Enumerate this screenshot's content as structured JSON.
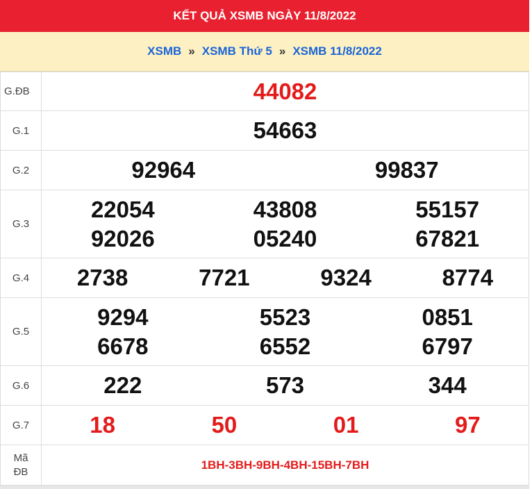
{
  "title": "KẾT QUẢ XSMB NGÀY 11/8/2022",
  "breadcrumb": [
    {
      "label": "XSMB"
    },
    {
      "label": "XSMB Thứ 5"
    },
    {
      "label": "XSMB 11/8/2022"
    }
  ],
  "breadcrumb_sep": "»",
  "prizes": {
    "db": {
      "label": "G.ĐB",
      "values": [
        "44082"
      ]
    },
    "g1": {
      "label": "G.1",
      "values": [
        "54663"
      ]
    },
    "g2": {
      "label": "G.2",
      "values": [
        "92964",
        "99837"
      ]
    },
    "g3": {
      "label": "G.3",
      "values": [
        "22054",
        "43808",
        "55157",
        "92026",
        "05240",
        "67821"
      ]
    },
    "g4": {
      "label": "G.4",
      "values": [
        "2738",
        "7721",
        "9324",
        "8774"
      ]
    },
    "g5": {
      "label": "G.5",
      "values": [
        "9294",
        "5523",
        "0851",
        "6678",
        "6552",
        "6797"
      ]
    },
    "g6": {
      "label": "G.6",
      "values": [
        "222",
        "573",
        "344"
      ]
    },
    "g7": {
      "label": "G.7",
      "values": [
        "18",
        "50",
        "01",
        "97"
      ]
    }
  },
  "ma_db": {
    "label_line1": "Mã",
    "label_line2": "ĐB",
    "value": "1BH-3BH-9BH-4BH-15BH-7BH"
  },
  "colors": {
    "header_red": "#e8202f",
    "crumb_bg": "#fdf1c4",
    "link_blue": "#1a64d6",
    "prize_red": "#e31b1b"
  }
}
